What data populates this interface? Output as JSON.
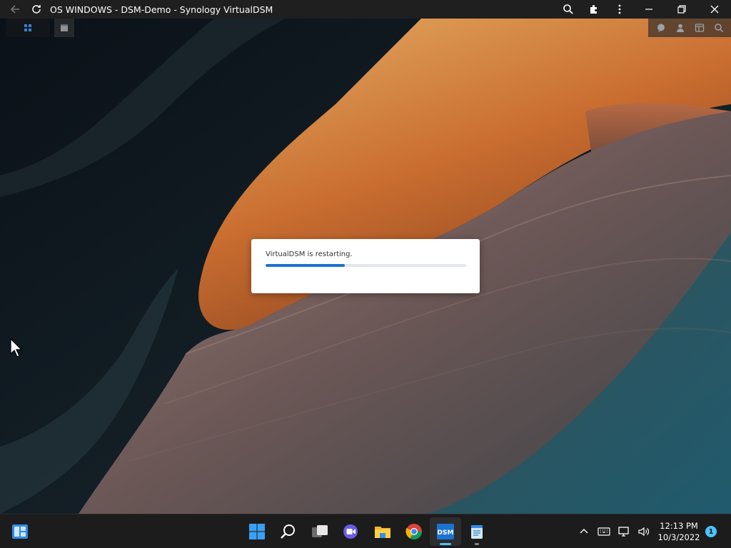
{
  "browser": {
    "title": "OS WINDOWS - DSM-Demo - Synology VirtualDSM",
    "icons": [
      "back-arrow-icon",
      "reload-icon",
      "zoom-icon",
      "extensions-icon",
      "more-icon",
      "minimize-icon",
      "restore-icon",
      "close-icon"
    ]
  },
  "dsm": {
    "topbar_left": [
      "main-menu-icon",
      "app-window-icon"
    ],
    "topbar_right": [
      "chat-icon",
      "user-icon",
      "widgets-icon",
      "search-icon"
    ]
  },
  "dialog": {
    "message": "VirtualDSM is restarting.",
    "progress": 0.395
  },
  "taskbar": {
    "apps": [
      {
        "name": "start",
        "icon": "windows-start-icon",
        "active": false,
        "running": false
      },
      {
        "name": "search",
        "icon": "search-icon",
        "active": false,
        "running": false
      },
      {
        "name": "task-view",
        "icon": "task-view-icon",
        "active": false,
        "running": false
      },
      {
        "name": "teams-chat",
        "icon": "video-chat-icon",
        "active": false,
        "running": false
      },
      {
        "name": "file-explorer",
        "icon": "folder-icon",
        "active": false,
        "running": false
      },
      {
        "name": "chrome",
        "icon": "chrome-icon",
        "active": false,
        "running": false
      },
      {
        "name": "dsm",
        "icon": "dsm-icon",
        "label": "DSM",
        "active": true,
        "running": true
      },
      {
        "name": "notepad",
        "icon": "notepad-icon",
        "active": false,
        "running": true
      }
    ],
    "tray_icons": [
      "chevron-up-icon",
      "keyboard-icon",
      "network-icon",
      "volume-icon"
    ],
    "time": "12:13 PM",
    "date": "10/3/2022",
    "notification_count": "1"
  },
  "colors": {
    "accent": "#4cc2ff",
    "progress": "#1a73d1",
    "taskbar": "#1c1c1c",
    "chrome": "#1f1f1f"
  }
}
